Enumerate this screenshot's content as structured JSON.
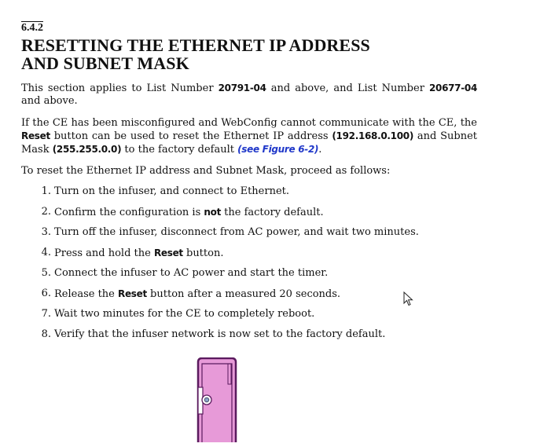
{
  "section": {
    "number": "6.4.2",
    "title_line1": "RESETTING THE ETHERNET IP ADDRESS",
    "title_line2": "AND SUBNET MASK"
  },
  "para1": {
    "t1": "This section applies to List Number ",
    "list1": "20791-04",
    "t2": " and above, and List Number ",
    "list2": "20677-04",
    "t3": " and above."
  },
  "para2": {
    "t1": "If the CE has been misconfigured and WebConfig cannot communicate with the CE, the ",
    "reset": "Reset",
    "t2": " button can be used to reset the Ethernet IP address ",
    "ip": "(192.168.0.100)",
    "t3": " and Subnet Mask ",
    "mask": "(255.255.0.0)",
    "t4": " to the factory default ",
    "figure_link": "(see Figure 6-2)",
    "t5": "."
  },
  "para3": "To reset the Ethernet IP address and Subnet Mask, proceed as follows:",
  "steps": [
    {
      "num": "1.",
      "pre": "Turn on the infuser, and connect to Ethernet.",
      "bold": "",
      "post": ""
    },
    {
      "num": "2.",
      "pre": "Confirm the configuration is ",
      "bold": "not",
      "post": " the factory default."
    },
    {
      "num": "3.",
      "pre": "Turn off the infuser, disconnect from AC power, and wait two minutes.",
      "bold": "",
      "post": ""
    },
    {
      "num": "4.",
      "pre": "Press and hold the ",
      "bold": "Reset",
      "post": " button."
    },
    {
      "num": "5.",
      "pre": "Connect the infuser to AC power and start the timer.",
      "bold": "",
      "post": ""
    },
    {
      "num": "6.",
      "pre": "Release the ",
      "bold": "Reset",
      "post": " button after a measured 20 seconds."
    },
    {
      "num": "7.",
      "pre": "Wait two minutes for the CE to completely reboot.",
      "bold": "",
      "post": ""
    },
    {
      "num": "8.",
      "pre": "Verify that the infuser network is now set to the factory default.",
      "bold": "",
      "post": ""
    }
  ],
  "colors": {
    "link": "#1f37c9",
    "device_fill": "#e79ad8",
    "device_outline": "#5a1a5e"
  }
}
